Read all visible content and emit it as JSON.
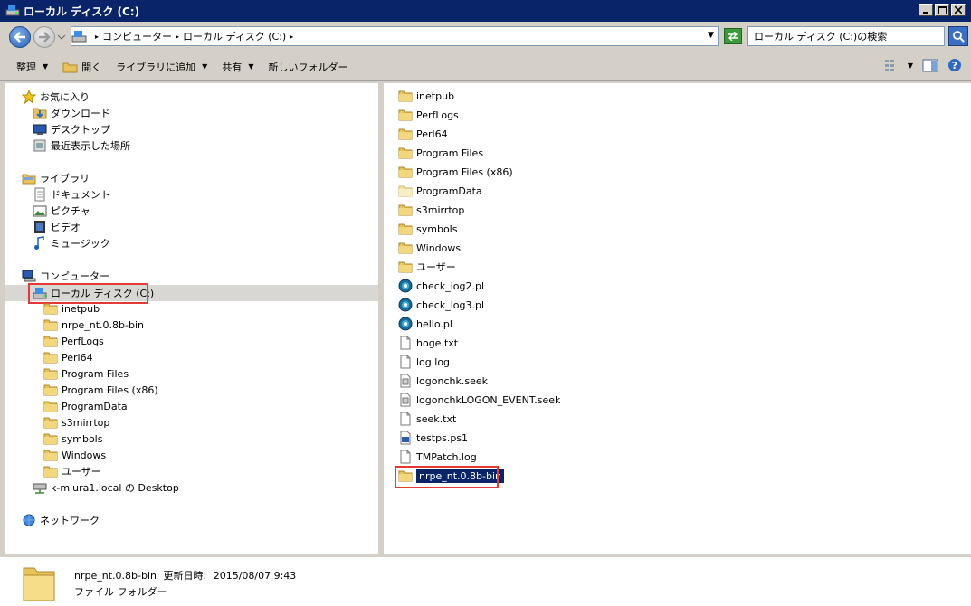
{
  "window": {
    "title": "ローカル ディスク (C:)"
  },
  "address": {
    "crumbs": [
      "コンピューター",
      "ローカル ディスク (C:)"
    ],
    "search_placeholder": "ローカル ディスク (C:)の検索"
  },
  "toolbar": {
    "organize": "整理",
    "open": "開く",
    "add_to_library": "ライブラリに追加",
    "share": "共有",
    "new_folder": "新しいフォルダー"
  },
  "nav": {
    "favorites": "お気に入り",
    "downloads": "ダウンロード",
    "desktop": "デスクトップ",
    "recent": "最近表示した場所",
    "libraries": "ライブラリ",
    "documents": "ドキュメント",
    "pictures": "ピクチャ",
    "videos": "ビデオ",
    "music": "ミュージック",
    "computer": "コンピューター",
    "local_disk": "ローカル ディスク (C:)",
    "subfolders": [
      "inetpub",
      "nrpe_nt.0.8b-bin",
      "PerfLogs",
      "Perl64",
      "Program Files",
      "Program Files (x86)",
      "ProgramData",
      "s3mirrtop",
      "symbols",
      "Windows",
      "ユーザー"
    ],
    "network_drive": "k-miura1.local の Desktop",
    "network": "ネットワーク"
  },
  "files": [
    {
      "name": "inetpub",
      "type": "folder"
    },
    {
      "name": "PerfLogs",
      "type": "folder"
    },
    {
      "name": "Perl64",
      "type": "folder"
    },
    {
      "name": "Program Files",
      "type": "folder"
    },
    {
      "name": "Program Files (x86)",
      "type": "folder"
    },
    {
      "name": "ProgramData",
      "type": "folder-light"
    },
    {
      "name": "s3mirrtop",
      "type": "folder"
    },
    {
      "name": "symbols",
      "type": "folder"
    },
    {
      "name": "Windows",
      "type": "folder"
    },
    {
      "name": "ユーザー",
      "type": "folder"
    },
    {
      "name": "check_log2.pl",
      "type": "perl"
    },
    {
      "name": "check_log3.pl",
      "type": "perl"
    },
    {
      "name": "hello.pl",
      "type": "perl"
    },
    {
      "name": "hoge.txt",
      "type": "text"
    },
    {
      "name": "log.log",
      "type": "text"
    },
    {
      "name": "logonchk.seek",
      "type": "seek"
    },
    {
      "name": "logonchkLOGON_EVENT.seek",
      "type": "seek"
    },
    {
      "name": "seek.txt",
      "type": "text"
    },
    {
      "name": "testps.ps1",
      "type": "ps1"
    },
    {
      "name": "TMPatch.log",
      "type": "text"
    },
    {
      "name": "nrpe_nt.0.8b-bin",
      "type": "folder",
      "selected": true
    }
  ],
  "details": {
    "name": "nrpe_nt.0.8b-bin",
    "modified_label": "更新日時:",
    "modified_value": "2015/08/07 9:43",
    "type": "ファイル フォルダー"
  }
}
